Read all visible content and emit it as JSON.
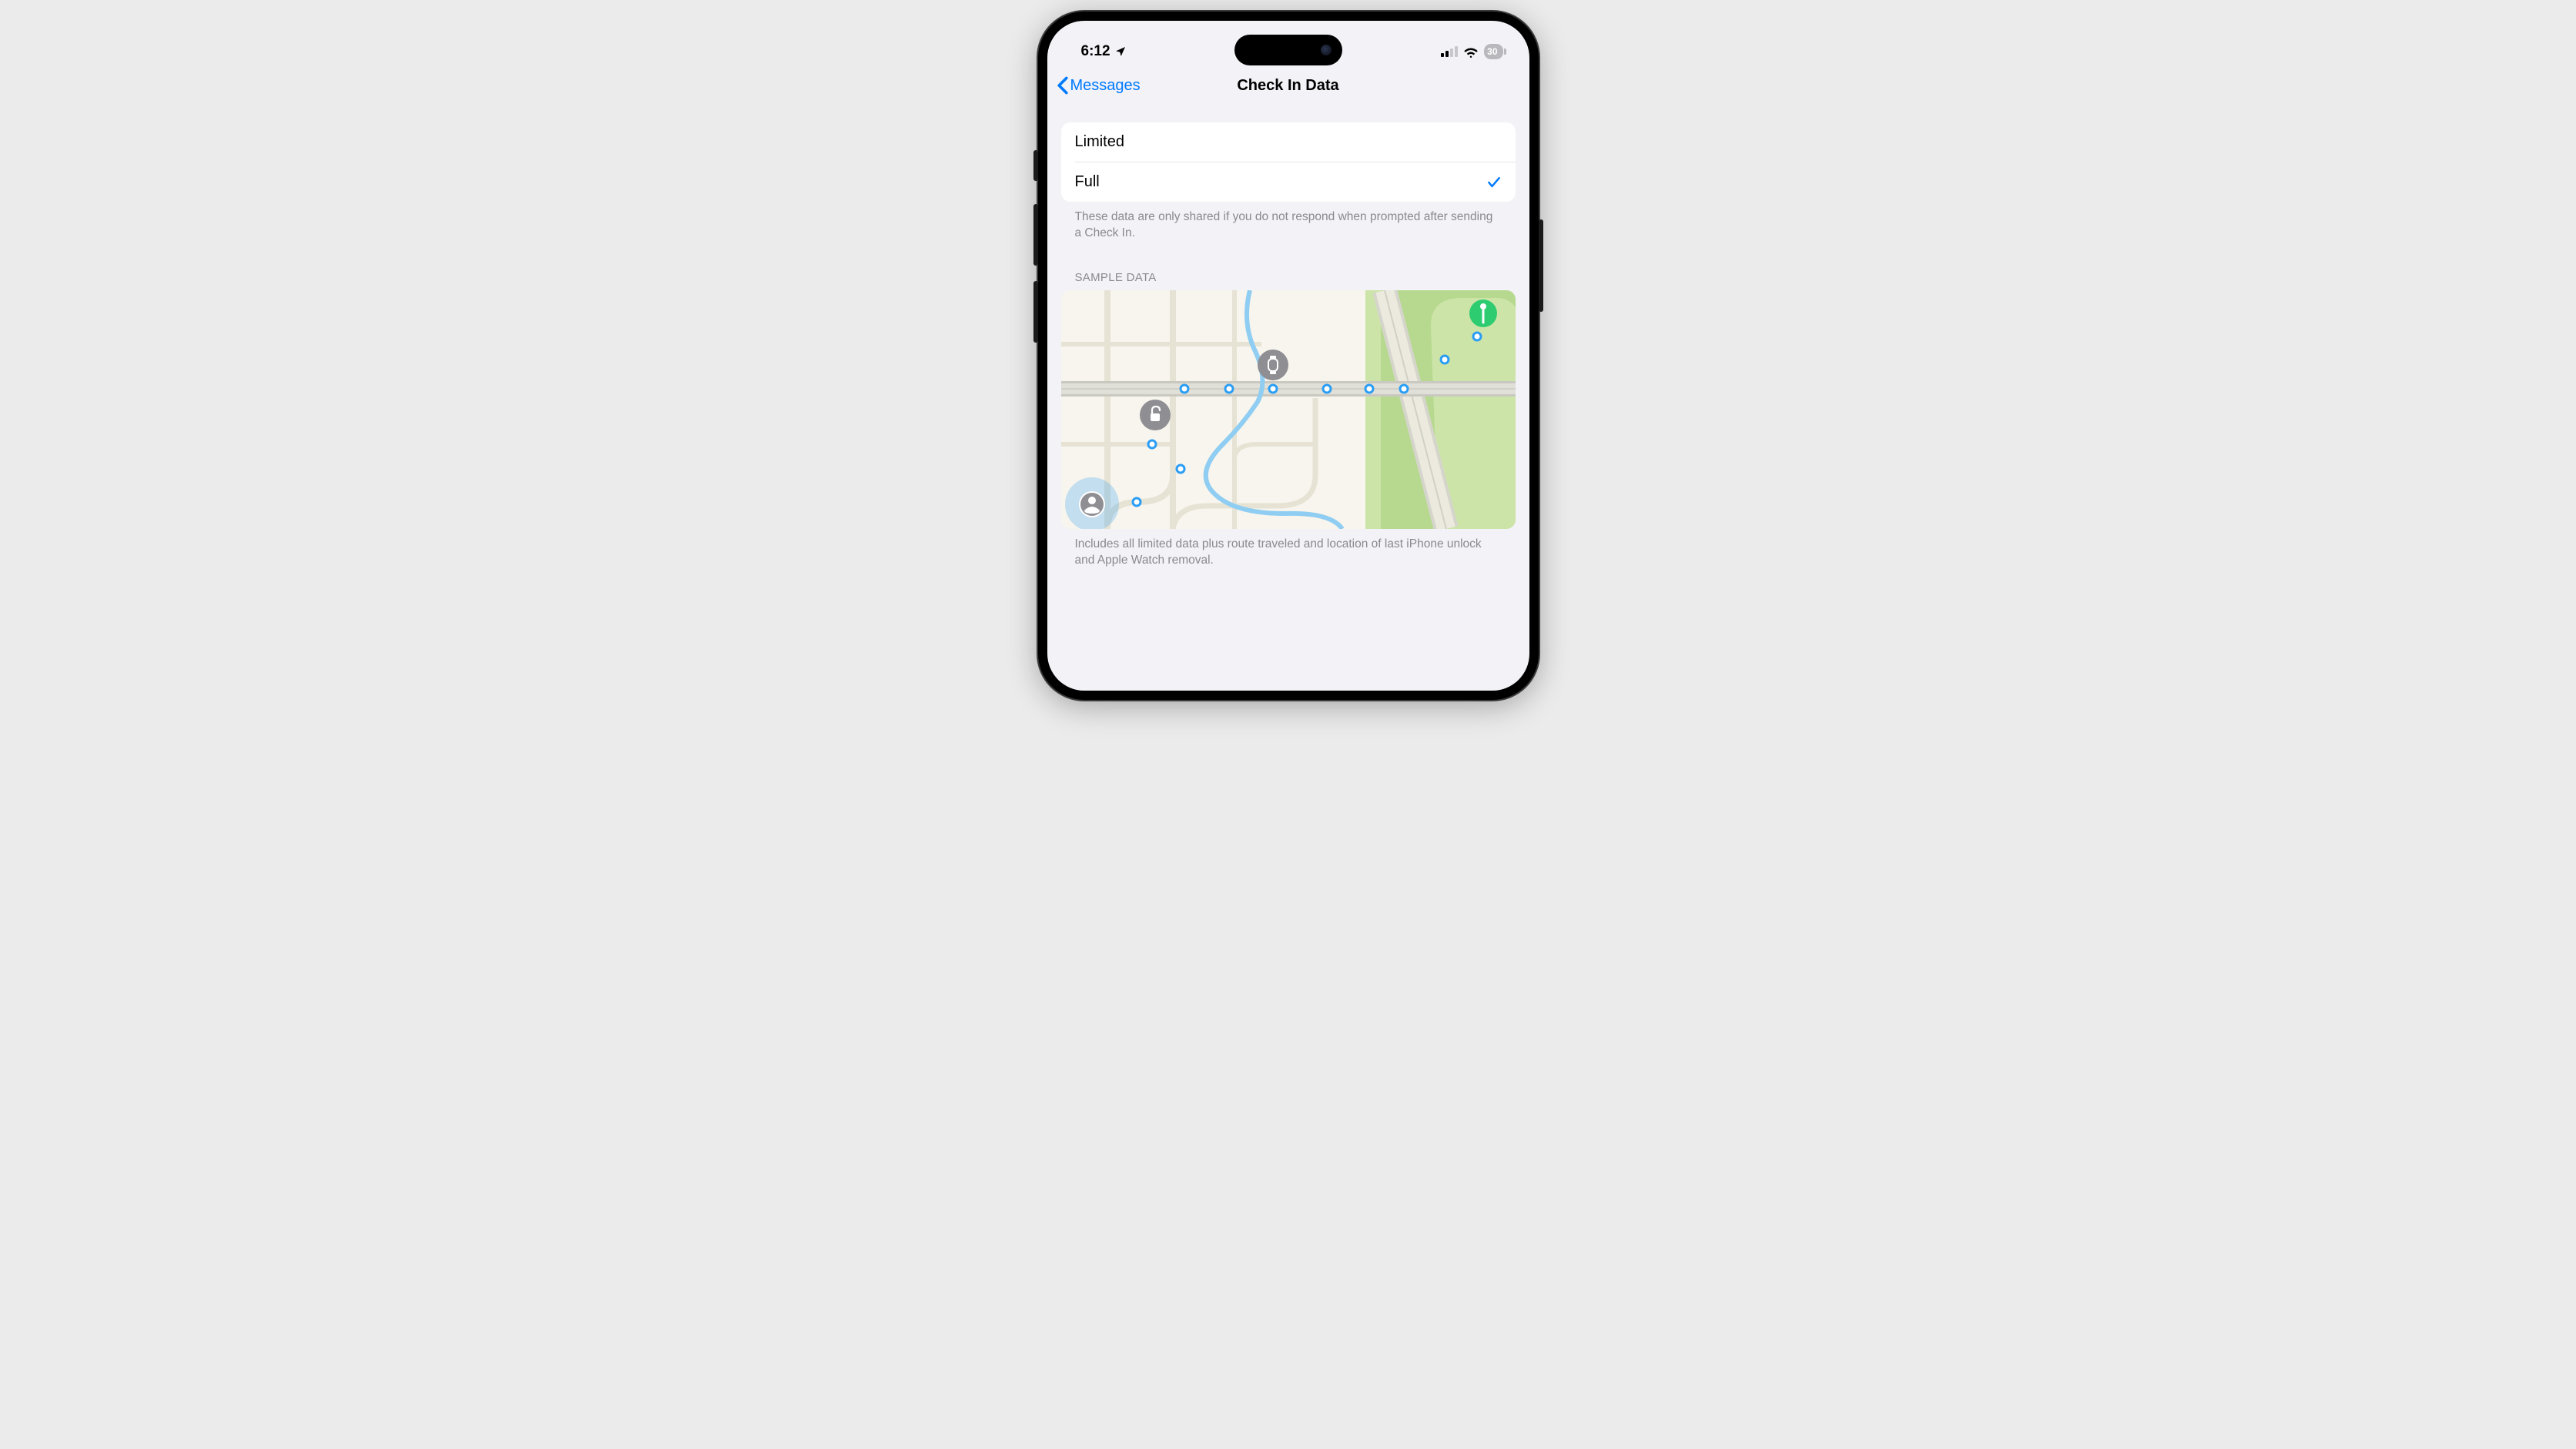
{
  "statusBar": {
    "time": "6:12",
    "batteryLevel": "30"
  },
  "navBar": {
    "backLabel": "Messages",
    "title": "Check In Data"
  },
  "options": {
    "limited": "Limited",
    "full": "Full",
    "selected": "full",
    "footer": "These data are only shared if you do not respond when prompted after sending a Check In."
  },
  "sample": {
    "header": "SAMPLE DATA",
    "footer": "Includes all limited data plus route traveled and location of last iPhone unlock and Apple Watch removal."
  }
}
